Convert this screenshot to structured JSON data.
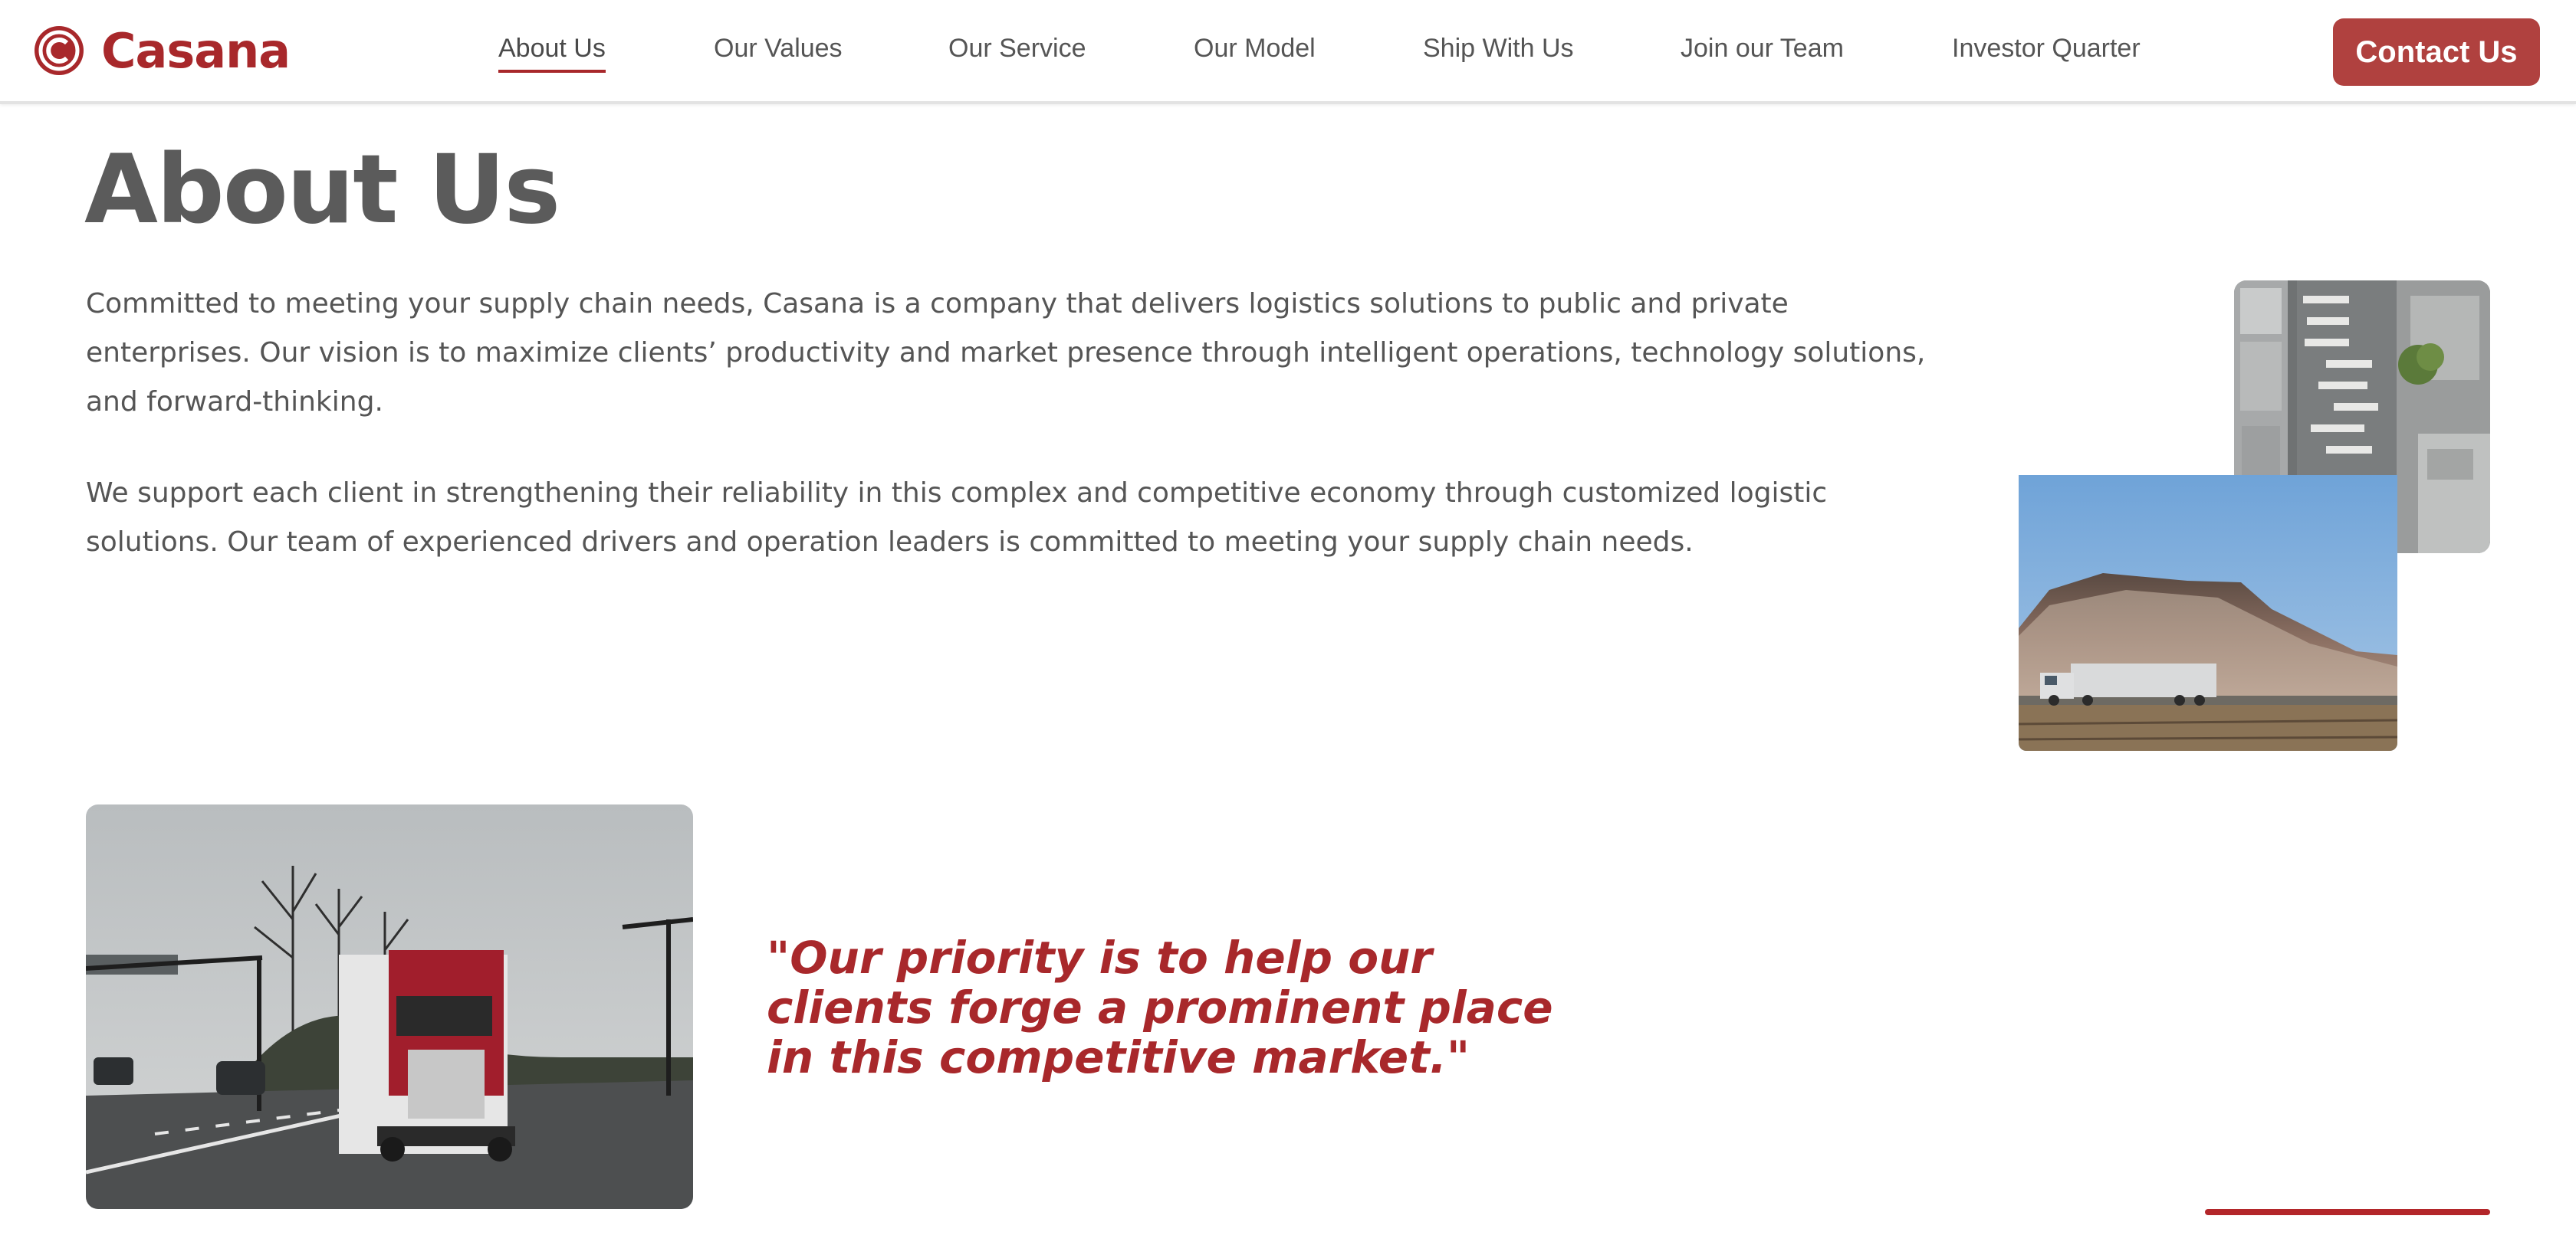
{
  "brand": {
    "name": "Casana",
    "logo_icon": "casana-logo-icon",
    "color": "#a8282b"
  },
  "nav": {
    "items": [
      {
        "label": "About Us",
        "active": true
      },
      {
        "label": "Our Values",
        "active": false
      },
      {
        "label": "Our Service",
        "active": false
      },
      {
        "label": "Our Model",
        "active": false
      },
      {
        "label": "Ship With Us",
        "active": false
      },
      {
        "label": "Join our Team",
        "active": false
      },
      {
        "label": "Investor Quarter",
        "active": false
      }
    ],
    "contact_label": "Contact Us",
    "contact_color": "#b0413f"
  },
  "main": {
    "title": "About Us",
    "paragraphs": [
      "Committed to meeting your supply chain needs, Casana is a company that delivers logistics solutions to public and private enterprises. Our vision is to maximize clients’ productivity and market presence through intelligent operations, technology solutions, and forward-thinking.",
      "We support each client in strengthening their reliability in this complex and competitive economy through customized logistic solutions. Our team of experienced drivers and operation leaders is committed to meeting your supply chain needs."
    ],
    "images": [
      {
        "name": "aerial-warehouse-photo"
      },
      {
        "name": "semi-truck-desert-mesa-photo"
      },
      {
        "name": "red-semi-truck-highway-photo"
      }
    ],
    "quote": "\"Our priority is to help our clients forge a prominent place in this competitive market.\"",
    "accent_color": "#b3262a"
  }
}
